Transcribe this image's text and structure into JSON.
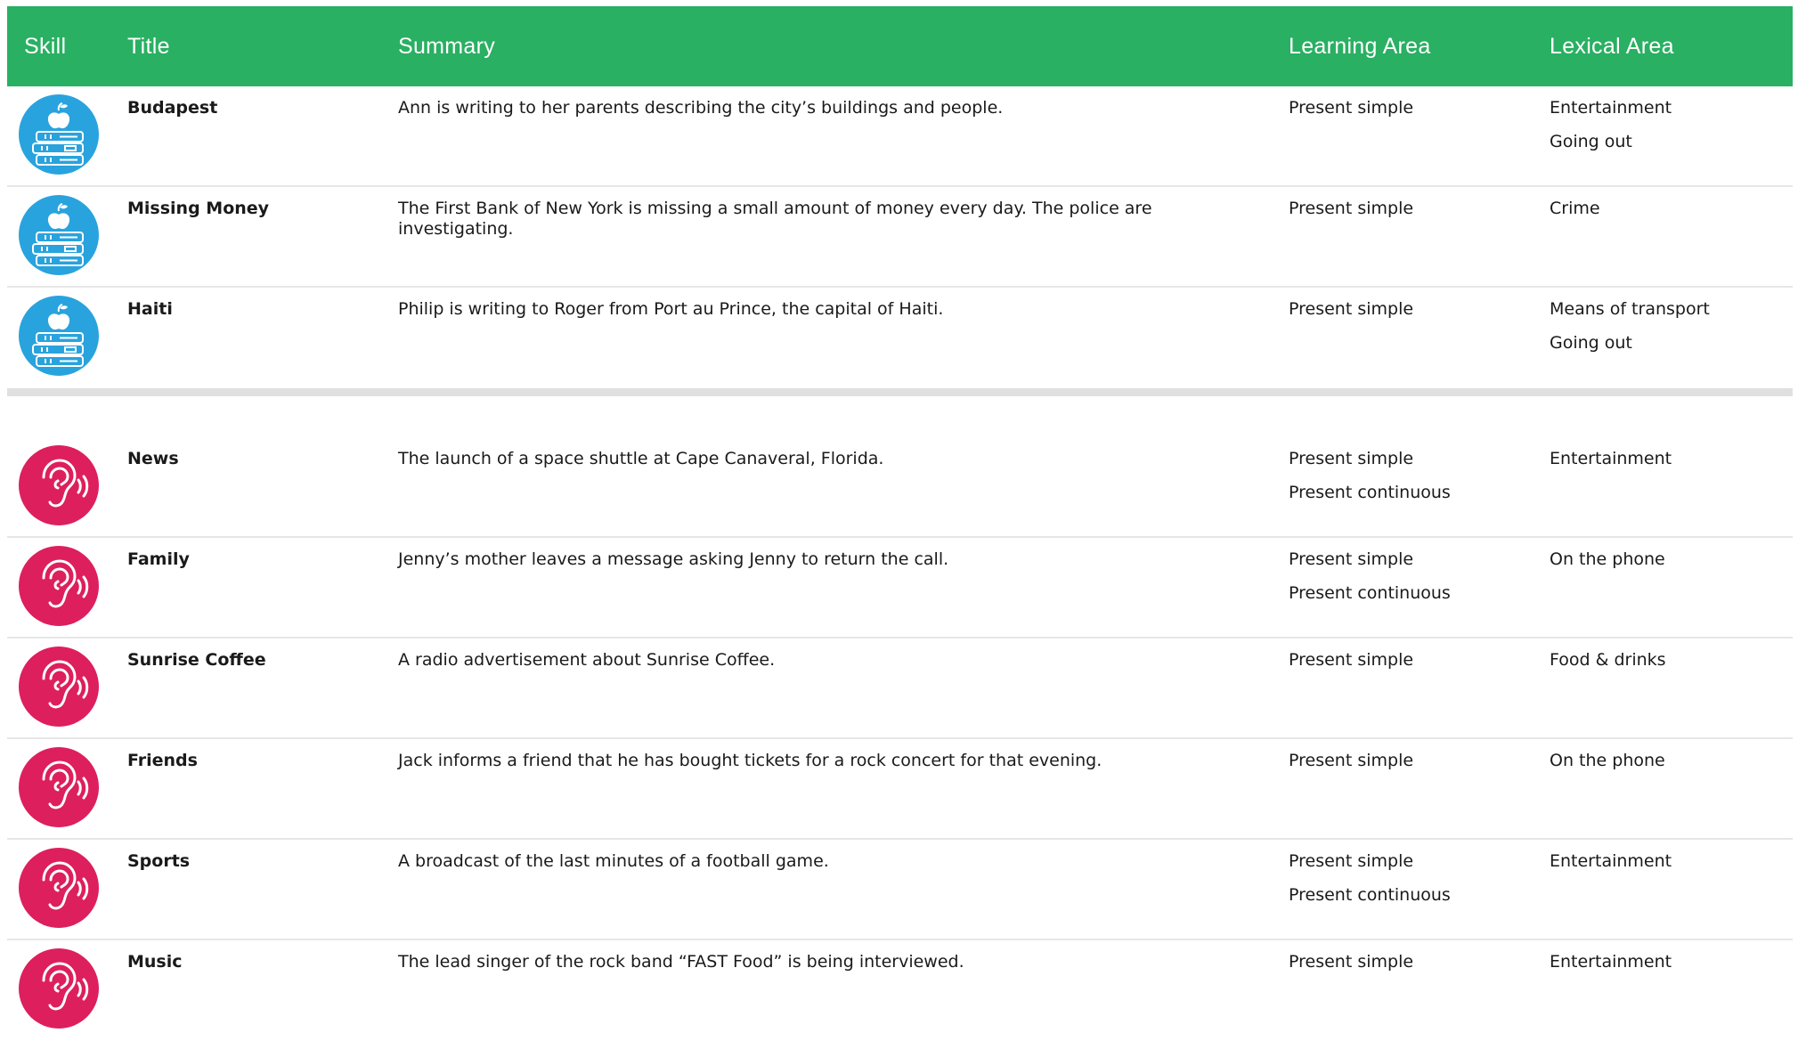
{
  "colors": {
    "header_bg": "#29b062",
    "reading_icon": "#29a3dd",
    "listening_icon": "#dd1f5e"
  },
  "headers": {
    "skill": "Skill",
    "title": "Title",
    "summary": "Summary",
    "learning": "Learning Area",
    "lexical": "Lexical Area"
  },
  "reading_rows": [
    {
      "icon": "books-apple-icon",
      "title": "Budapest",
      "summary": "Ann is writing to her parents describing the city’s buildings and people.",
      "learning": [
        "Present simple",
        ""
      ],
      "lexical": [
        "Entertainment",
        "Going out"
      ]
    },
    {
      "icon": "books-apple-icon",
      "title": "Missing Money",
      "summary": "The First Bank of New York is missing a small amount of money every day. The police are investigating.",
      "learning": [
        "Present simple",
        ""
      ],
      "lexical": [
        "Crime",
        ""
      ]
    },
    {
      "icon": "books-apple-icon",
      "title": "Haiti",
      "summary": "Philip is writing to Roger from Port au Prince, the capital of Haiti.",
      "learning": [
        "Present simple",
        ""
      ],
      "lexical": [
        "Means of transport",
        "Going out"
      ]
    }
  ],
  "listening_rows": [
    {
      "icon": "ear-listening-icon",
      "title": "News",
      "summary": "The launch of a space shuttle at Cape Canaveral, Florida.",
      "learning": [
        "Present simple",
        "Present continuous"
      ],
      "lexical": [
        "Entertainment",
        ""
      ]
    },
    {
      "icon": "ear-listening-icon",
      "title": "Family",
      "summary": "Jenny’s mother leaves a message asking Jenny to return the call.",
      "learning": [
        "Present simple",
        "Present continuous"
      ],
      "lexical": [
        "On the phone",
        ""
      ]
    },
    {
      "icon": "ear-listening-icon",
      "title": "Sunrise Coffee",
      "summary": "A radio advertisement about Sunrise Coffee.",
      "learning": [
        "Present simple",
        ""
      ],
      "lexical": [
        "Food & drinks",
        ""
      ]
    },
    {
      "icon": "ear-listening-icon",
      "title": "Friends",
      "summary": "Jack informs a friend that he has bought tickets for a rock concert for that evening.",
      "learning": [
        "Present simple",
        ""
      ],
      "lexical": [
        "On the phone",
        ""
      ]
    },
    {
      "icon": "ear-listening-icon",
      "title": "Sports",
      "summary": "A broadcast of the last minutes of a football game.",
      "learning": [
        "Present simple",
        "Present continuous"
      ],
      "lexical": [
        "Entertainment",
        ""
      ]
    },
    {
      "icon": "ear-listening-icon",
      "title": "Music",
      "summary": "The lead singer of the rock band “FAST Food” is being interviewed.",
      "learning": [
        "Present simple",
        ""
      ],
      "lexical": [
        "Entertainment",
        ""
      ]
    }
  ]
}
